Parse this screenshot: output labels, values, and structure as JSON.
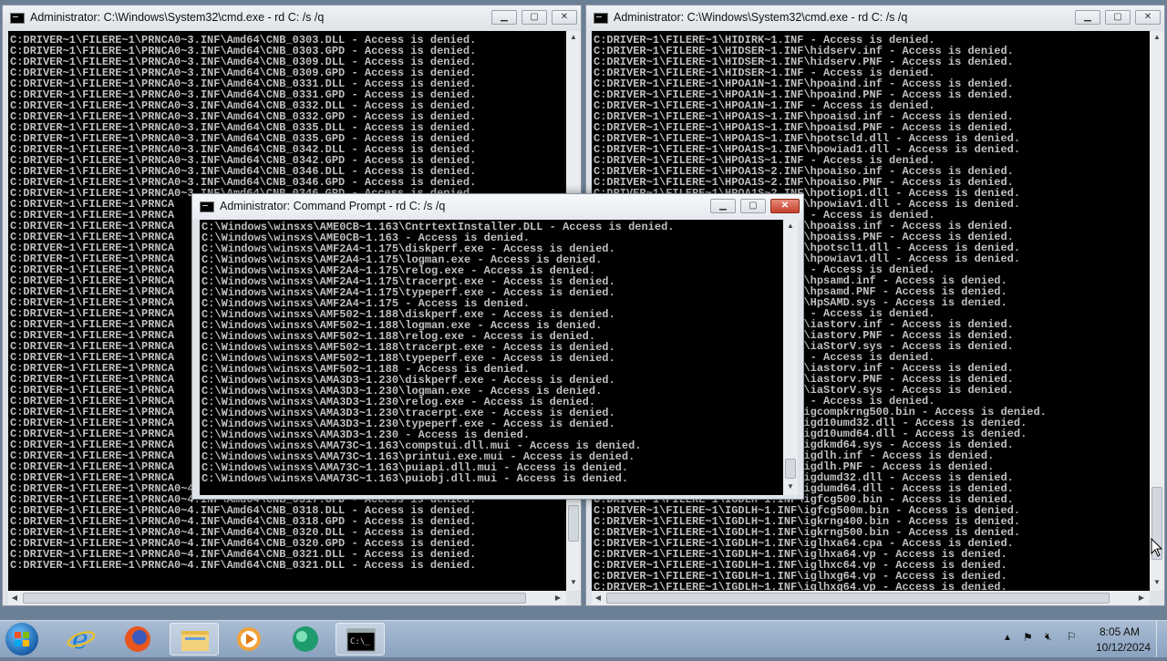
{
  "windows": {
    "left": {
      "title": "Administrator: C:\\Windows\\System32\\cmd.exe - rd  C: /s /q",
      "lines": [
        "C:DRIVER~1\\FILERE~1\\PRNCA0~3.INF\\Amd64\\CNB_0303.DLL - Access is denied.",
        "C:DRIVER~1\\FILERE~1\\PRNCA0~3.INF\\Amd64\\CNB_0303.GPD - Access is denied.",
        "C:DRIVER~1\\FILERE~1\\PRNCA0~3.INF\\Amd64\\CNB_0309.DLL - Access is denied.",
        "C:DRIVER~1\\FILERE~1\\PRNCA0~3.INF\\Amd64\\CNB_0309.GPD - Access is denied.",
        "C:DRIVER~1\\FILERE~1\\PRNCA0~3.INF\\Amd64\\CNB_0331.DLL - Access is denied.",
        "C:DRIVER~1\\FILERE~1\\PRNCA0~3.INF\\Amd64\\CNB_0331.GPD - Access is denied.",
        "C:DRIVER~1\\FILERE~1\\PRNCA0~3.INF\\Amd64\\CNB_0332.DLL - Access is denied.",
        "C:DRIVER~1\\FILERE~1\\PRNCA0~3.INF\\Amd64\\CNB_0332.GPD - Access is denied.",
        "C:DRIVER~1\\FILERE~1\\PRNCA0~3.INF\\Amd64\\CNB_0335.DLL - Access is denied.",
        "C:DRIVER~1\\FILERE~1\\PRNCA0~3.INF\\Amd64\\CNB_0335.GPD - Access is denied.",
        "C:DRIVER~1\\FILERE~1\\PRNCA0~3.INF\\Amd64\\CNB_0342.DLL - Access is denied.",
        "C:DRIVER~1\\FILERE~1\\PRNCA0~3.INF\\Amd64\\CNB_0342.GPD - Access is denied.",
        "C:DRIVER~1\\FILERE~1\\PRNCA0~3.INF\\Amd64\\CNB_0346.DLL - Access is denied.",
        "C:DRIVER~1\\FILERE~1\\PRNCA0~3.INF\\Amd64\\CNB_0346.GPD - Access is denied.",
        "C:DRIVER~1\\FILERE~1\\PRNCA0~3.INF\\Amd64\\CNB_0346.GPD - Access is denied.",
        "C:DRIVER~1\\FILERE~1\\PRNCA",
        "C:DRIVER~1\\FILERE~1\\PRNCA",
        "C:DRIVER~1\\FILERE~1\\PRNCA",
        "C:DRIVER~1\\FILERE~1\\PRNCA",
        "C:DRIVER~1\\FILERE~1\\PRNCA",
        "C:DRIVER~1\\FILERE~1\\PRNCA",
        "C:DRIVER~1\\FILERE~1\\PRNCA",
        "C:DRIVER~1\\FILERE~1\\PRNCA",
        "C:DRIVER~1\\FILERE~1\\PRNCA",
        "C:DRIVER~1\\FILERE~1\\PRNCA",
        "C:DRIVER~1\\FILERE~1\\PRNCA",
        "C:DRIVER~1\\FILERE~1\\PRNCA",
        "C:DRIVER~1\\FILERE~1\\PRNCA",
        "C:DRIVER~1\\FILERE~1\\PRNCA",
        "C:DRIVER~1\\FILERE~1\\PRNCA",
        "C:DRIVER~1\\FILERE~1\\PRNCA",
        "C:DRIVER~1\\FILERE~1\\PRNCA",
        "C:DRIVER~1\\FILERE~1\\PRNCA",
        "C:DRIVER~1\\FILERE~1\\PRNCA",
        "C:DRIVER~1\\FILERE~1\\PRNCA",
        "C:DRIVER~1\\FILERE~1\\PRNCA",
        "C:DRIVER~1\\FILERE~1\\PRNCA",
        "C:DRIVER~1\\FILERE~1\\PRNCA",
        "C:DRIVER~1\\FILERE~1\\PRNCA",
        "C:DRIVER~1\\FILERE~1\\PRNCA",
        "C:DRIVER~1\\FILERE~1\\PRNCA",
        "C:DRIVER~1\\FILERE~1\\PRNCA0~4.INF\\Amd64\\CNB_0317.DLL - Access is denied.",
        "C:DRIVER~1\\FILERE~1\\PRNCA0~4.INF\\Amd64\\CNB_0317.GPD - Access is denied.",
        "C:DRIVER~1\\FILERE~1\\PRNCA0~4.INF\\Amd64\\CNB_0318.DLL - Access is denied.",
        "C:DRIVER~1\\FILERE~1\\PRNCA0~4.INF\\Amd64\\CNB_0318.GPD - Access is denied.",
        "C:DRIVER~1\\FILERE~1\\PRNCA0~4.INF\\Amd64\\CNB_0320.DLL - Access is denied.",
        "C:DRIVER~1\\FILERE~1\\PRNCA0~4.INF\\Amd64\\CNB_0320.GPD - Access is denied.",
        "C:DRIVER~1\\FILERE~1\\PRNCA0~4.INF\\Amd64\\CNB_0321.DLL - Access is denied.",
        "C:DRIVER~1\\FILERE~1\\PRNCA0~4.INF\\Amd64\\CNB_0321.DLL - Access is denied."
      ]
    },
    "right": {
      "title": "Administrator: C:\\Windows\\System32\\cmd.exe - rd  C: /s /q",
      "lines": [
        "C:DRIVER~1\\FILERE~1\\HIDIRK~1.INF - Access is denied.",
        "C:DRIVER~1\\FILERE~1\\HIDSER~1.INF\\hidserv.inf - Access is denied.",
        "C:DRIVER~1\\FILERE~1\\HIDSER~1.INF\\hidserv.PNF - Access is denied.",
        "C:DRIVER~1\\FILERE~1\\HIDSER~1.INF - Access is denied.",
        "C:DRIVER~1\\FILERE~1\\HPOA1N~1.INF\\hpoaind.inf - Access is denied.",
        "C:DRIVER~1\\FILERE~1\\HPOA1N~1.INF\\hpoaind.PNF - Access is denied.",
        "C:DRIVER~1\\FILERE~1\\HPOA1N~1.INF - Access is denied.",
        "C:DRIVER~1\\FILERE~1\\HPOA1S~1.INF\\hpoaisd.inf - Access is denied.",
        "C:DRIVER~1\\FILERE~1\\HPOA1S~1.INF\\hpoaisd.PNF - Access is denied.",
        "C:DRIVER~1\\FILERE~1\\HPOA1S~1.INF\\hpotscld.dll - Access is denied.",
        "C:DRIVER~1\\FILERE~1\\HPOA1S~1.INF\\hpowiad1.dll - Access is denied.",
        "C:DRIVER~1\\FILERE~1\\HPOA1S~1.INF - Access is denied.",
        "C:DRIVER~1\\FILERE~1\\HPOA1S~2.INF\\hpoaiso.inf - Access is denied.",
        "C:DRIVER~1\\FILERE~1\\HPOA1S~2.INF\\hpoaiso.PNF - Access is denied.",
        "C:DRIVER~1\\FILERE~1\\HPOA1S~2.INF\\hpotiop1.dll - Access is denied.",
        "C:DRIVER~1\\FILERE~1\\HPOA1S~2.INF\\hpowiav1.dll - Access is denied.",
        "C:DRIVER~1\\FILERE~1\\HPOA1S~2.INF - Access is denied.",
        "C:DRIVER~1\\FILERE~1\\HPOA1S~3.INF\\hpoaiss.inf - Access is denied.",
        "C:DRIVER~1\\FILERE~1\\HPOA1S~3.INF\\hpoaiss.PNF - Access is denied.",
        "C:DRIVER~1\\FILERE~1\\HPOA1S~3.INF\\hpotscl1.dll - Access is denied.",
        "C:DRIVER~1\\FILERE~1\\HPOA1S~3.INF\\hpowiav1.dll - Access is denied.",
        "C:DRIVER~1\\FILERE~1\\HPOA1S~3.INF - Access is denied.",
        "C:DRIVER~1\\FILERE~1\\HPSAMD~1.INF\\hpsamd.inf - Access is denied.",
        "C:DRIVER~1\\FILERE~1\\HPSAMD~1.INF\\hpsamd.PNF - Access is denied.",
        "C:DRIVER~1\\FILERE~1\\HPSAMD~1.INF\\HpSAMD.sys - Access is denied.",
        "C:DRIVER~1\\FILERE~1\\HPSAMD~1.INF - Access is denied.",
        "C:DRIVER~1\\FILERE~1\\IASTOR~1.INF\\iastorv.inf - Access is denied.",
        "C:DRIVER~1\\FILERE~1\\IASTOR~1.INF\\iastorv.PNF - Access is denied.",
        "C:DRIVER~1\\FILERE~1\\IASTOR~1.INF\\iaStorV.sys - Access is denied.",
        "C:DRIVER~1\\FILERE~1\\IASTOR~1.INF - Access is denied.",
        "C:DRIVER~1\\FILERE~1\\IASTOR~2.INF\\iastorv.inf - Access is denied.",
        "C:DRIVER~1\\FILERE~1\\IASTOR~2.INF\\iastorv.PNF - Access is denied.",
        "C:DRIVER~1\\FILERE~1\\IASTOR~2.INF\\iaStorV.sys - Access is denied.",
        "C:DRIVER~1\\FILERE~1\\IASTOR~2.INF - Access is denied.",
        "C:DRIVER~1\\FILERE~1\\IGDLH~1.INF\\igcompkrng500.bin - Access is denied.",
        "C:DRIVER~1\\FILERE~1\\IGDLH~1.INF\\igd10umd32.dll - Access is denied.",
        "C:DRIVER~1\\FILERE~1\\IGDLH~1.INF\\igd10umd64.dll - Access is denied.",
        "C:DRIVER~1\\FILERE~1\\IGDLH~1.INF\\igdkmd64.sys - Access is denied.",
        "C:DRIVER~1\\FILERE~1\\IGDLH~1.INF\\igdlh.inf - Access is denied.",
        "C:DRIVER~1\\FILERE~1\\IGDLH~1.INF\\igdlh.PNF - Access is denied.",
        "C:DRIVER~1\\FILERE~1\\IGDLH~1.INF\\igdumd32.dll - Access is denied.",
        "C:DRIVER~1\\FILERE~1\\IGDLH~1.INF\\igdumd64.dll - Access is denied.",
        "C:DRIVER~1\\FILERE~1\\IGDLH~1.INF\\igfcg500.bin - Access is denied.",
        "C:DRIVER~1\\FILERE~1\\IGDLH~1.INF\\igfcg500m.bin - Access is denied.",
        "C:DRIVER~1\\FILERE~1\\IGDLH~1.INF\\igkrng400.bin - Access is denied.",
        "C:DRIVER~1\\FILERE~1\\IGDLH~1.INF\\igkrng500.bin - Access is denied.",
        "C:DRIVER~1\\FILERE~1\\IGDLH~1.INF\\iglhxa64.cpa - Access is denied.",
        "C:DRIVER~1\\FILERE~1\\IGDLH~1.INF\\iglhxa64.vp - Access is denied.",
        "C:DRIVER~1\\FILERE~1\\IGDLH~1.INF\\iglhxc64.vp - Access is denied.",
        "C:DRIVER~1\\FILERE~1\\IGDLH~1.INF\\iglhxg64.vp - Access is denied.",
        "C:DRIVER~1\\FILERE~1\\IGDLH~1.INF\\iglhxg64.vp - Access is denied."
      ]
    },
    "center": {
      "title": "Administrator:  Command Prompt - rd  C: /s /q",
      "lines": [
        "C:\\Windows\\winsxs\\AME0CB~1.163\\CntrtextInstaller.DLL - Access is denied.",
        "C:\\Windows\\winsxs\\AME0CB~1.163 - Access is denied.",
        "C:\\Windows\\winsxs\\AMF2A4~1.175\\diskperf.exe - Access is denied.",
        "C:\\Windows\\winsxs\\AMF2A4~1.175\\logman.exe - Access is denied.",
        "C:\\Windows\\winsxs\\AMF2A4~1.175\\relog.exe - Access is denied.",
        "C:\\Windows\\winsxs\\AMF2A4~1.175\\tracerpt.exe - Access is denied.",
        "C:\\Windows\\winsxs\\AMF2A4~1.175\\typeperf.exe - Access is denied.",
        "C:\\Windows\\winsxs\\AMF2A4~1.175 - Access is denied.",
        "C:\\Windows\\winsxs\\AMF502~1.188\\diskperf.exe - Access is denied.",
        "C:\\Windows\\winsxs\\AMF502~1.188\\logman.exe - Access is denied.",
        "C:\\Windows\\winsxs\\AMF502~1.188\\relog.exe - Access is denied.",
        "C:\\Windows\\winsxs\\AMF502~1.188\\tracerpt.exe - Access is denied.",
        "C:\\Windows\\winsxs\\AMF502~1.188\\typeperf.exe - Access is denied.",
        "C:\\Windows\\winsxs\\AMF502~1.188 - Access is denied.",
        "C:\\Windows\\winsxs\\AMA3D3~1.230\\diskperf.exe - Access is denied.",
        "C:\\Windows\\winsxs\\AMA3D3~1.230\\logman.exe - Access is denied.",
        "C:\\Windows\\winsxs\\AMA3D3~1.230\\relog.exe - Access is denied.",
        "C:\\Windows\\winsxs\\AMA3D3~1.230\\tracerpt.exe - Access is denied.",
        "C:\\Windows\\winsxs\\AMA3D3~1.230\\typeperf.exe - Access is denied.",
        "C:\\Windows\\winsxs\\AMA3D3~1.230 - Access is denied.",
        "C:\\Windows\\winsxs\\AMA73C~1.163\\compstui.dll.mui - Access is denied.",
        "C:\\Windows\\winsxs\\AMA73C~1.163\\printui.exe.mui - Access is denied.",
        "C:\\Windows\\winsxs\\AMA73C~1.163\\puiapi.dll.mui - Access is denied.",
        "C:\\Windows\\winsxs\\AMA73C~1.163\\puiobj.dll.mui - Access is denied."
      ]
    }
  },
  "taskbar": {
    "icons": [
      "start-orb-icon",
      "internet-explorer-icon",
      "firefox-icon",
      "file-explorer-icon",
      "media-player-icon",
      "app-green-icon",
      "command-prompt-icon"
    ],
    "time": "8:05 AM",
    "date": "10/12/2024"
  }
}
